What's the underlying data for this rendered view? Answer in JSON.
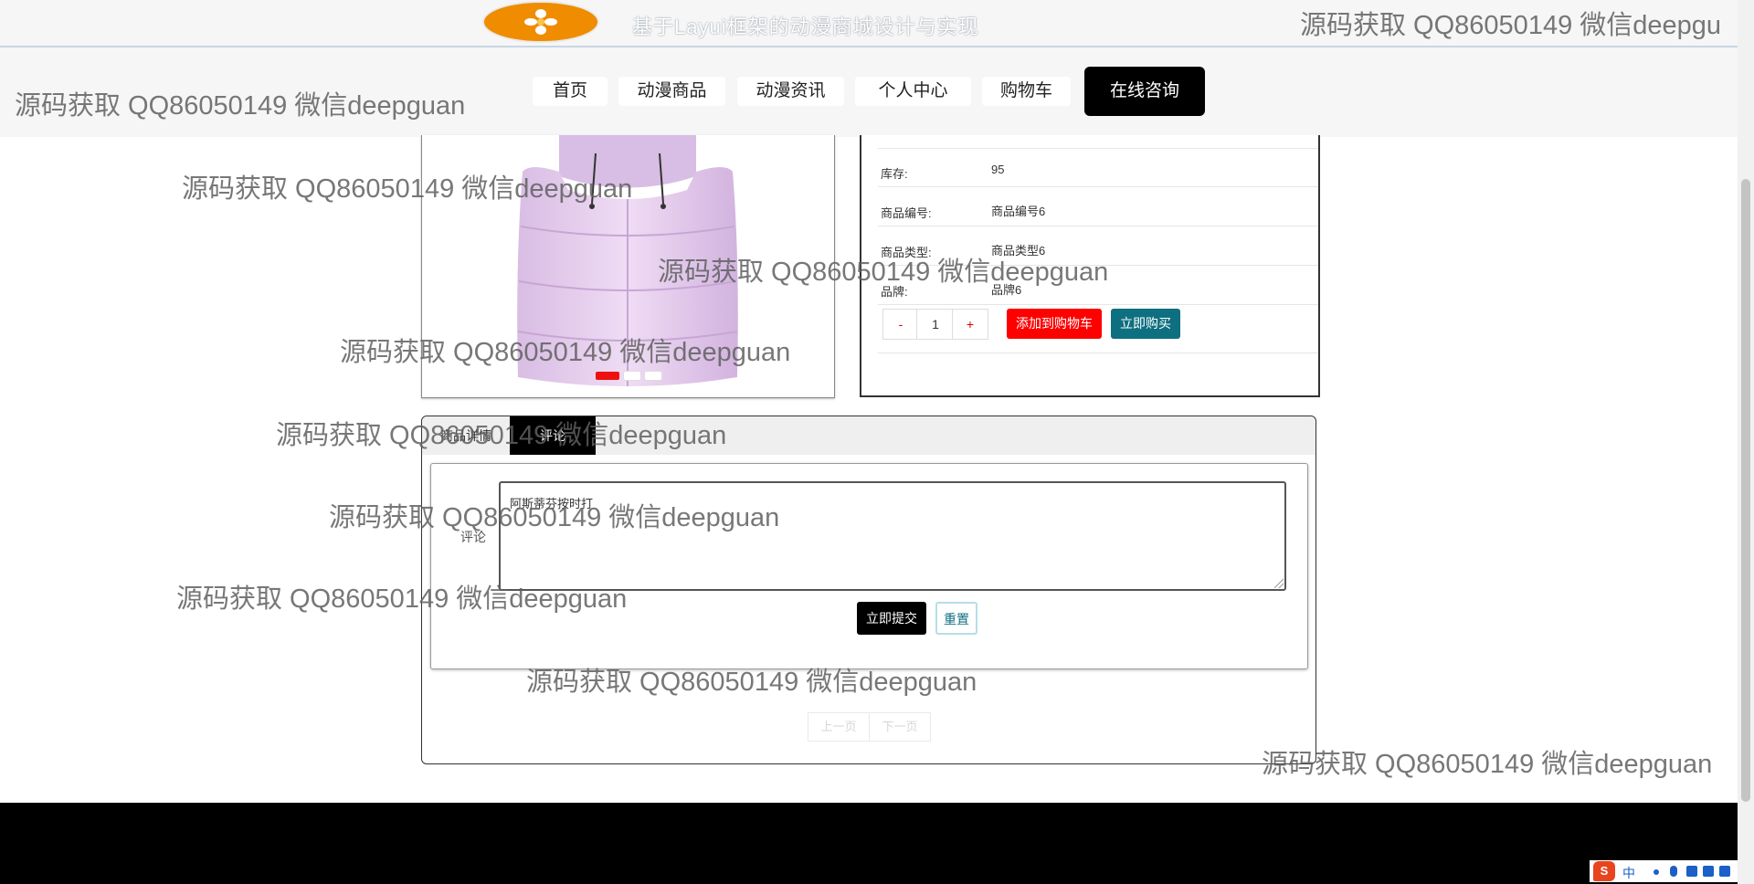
{
  "header": {
    "site_title": "基于Layui框架的动漫商城设计与实现"
  },
  "nav": {
    "items": [
      "首页",
      "动漫商品",
      "动漫资讯",
      "个人中心",
      "购物车"
    ],
    "consult_label": "在线咨询"
  },
  "product": {
    "carousel_dots": 3,
    "carousel_active": 0,
    "fields": [
      {
        "label": "库存:",
        "value": "95"
      },
      {
        "label": "商品编号:",
        "value": "商品编号6"
      },
      {
        "label": "商品类型:",
        "value": "商品类型6"
      },
      {
        "label": "品牌:",
        "value": "品牌6"
      }
    ],
    "quantity": {
      "minus": "-",
      "value": "1",
      "plus": "+"
    },
    "add_to_cart_label": "添加到购物车",
    "buy_now_label": "立即购买"
  },
  "tabs": {
    "items": [
      {
        "label": "商品详情",
        "active": false
      },
      {
        "label": "评论",
        "active": true
      }
    ]
  },
  "comment": {
    "label": "评论",
    "text": "阿斯蒂芬按时打",
    "submit_label": "立即提交",
    "reset_label": "重置"
  },
  "pager": {
    "prev_label": "上一页",
    "next_label": "下一页"
  },
  "watermark_text": "源码获取 QQ86050149 微信deepguan",
  "watermark_cut_text": "源码获取 QQ86050149 微信deepgu",
  "tray": {
    "ime_label": "中"
  },
  "colors": {
    "consult_bg": "#000000",
    "add_to_cart": "#ff0000",
    "buy_now": "#0e6f80",
    "carousel_active": "#ee1111",
    "logo": "#f08c00"
  }
}
